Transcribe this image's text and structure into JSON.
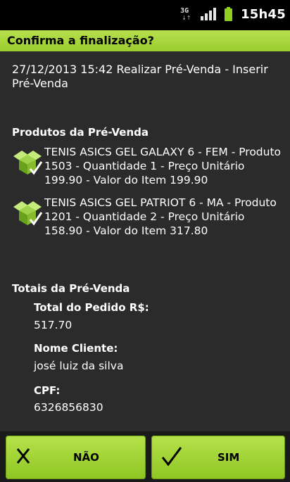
{
  "status_bar": {
    "network_type": "3G",
    "time": "15h45",
    "icons": [
      "3g-data-icon",
      "signal-icon",
      "battery-icon"
    ]
  },
  "dialog": {
    "title": "Confirma a finalização?",
    "header_line": "27/12/2013 15:42 Realizar Pré-Venda - Inserir Pré-Venda",
    "products_title": "Produtos da Pré-Venda",
    "products": [
      {
        "icon": "box-check-icon",
        "text": "TENIS ASICS GEL GALAXY 6 - FEM - Produto 1503 - Quantidade 1 - Preço Unitário 199.90 - Valor do Item 199.90"
      },
      {
        "icon": "box-check-icon",
        "text": "TENIS ASICS GEL PATRIOT 6 - MA - Produto 1201 - Quantidade 2 - Preço Unitário 158.90 - Valor do Item 317.80"
      }
    ],
    "totals_title": "Totais da Pré-Venda",
    "total_label": "Total do Pedido R$:",
    "total_value": "517.70",
    "client_label": "Nome Cliente:",
    "client_value": "josé luiz da silva",
    "cpf_label": "CPF:",
    "cpf_value": "6326856830"
  },
  "buttons": {
    "no_label": "NÃO",
    "yes_label": "SIM"
  },
  "colors": {
    "accent_green": "#9acc2e",
    "content_bg": "#2b2b2b"
  }
}
